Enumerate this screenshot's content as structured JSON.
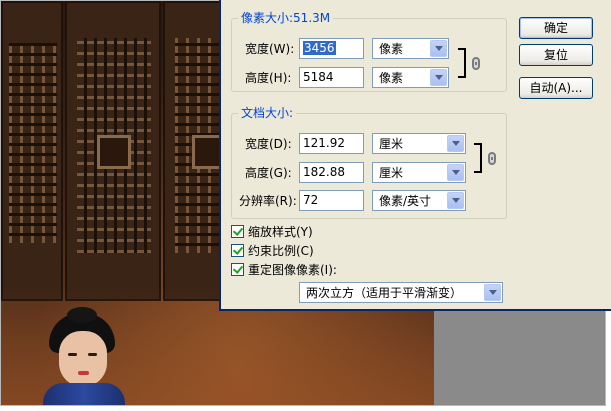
{
  "dialog": {
    "pixel_dimensions": {
      "title": "像素大小:51.3M",
      "width": {
        "label": "宽度(W):",
        "value": "3456",
        "unit": "像素"
      },
      "height": {
        "label": "高度(H):",
        "value": "5184",
        "unit": "像素"
      }
    },
    "document_size": {
      "title": "文档大小:",
      "width": {
        "label": "宽度(D):",
        "value": "121.92",
        "unit": "厘米"
      },
      "height": {
        "label": "高度(G):",
        "value": "182.88",
        "unit": "厘米"
      },
      "resolution": {
        "label": "分辨率(R):",
        "value": "72",
        "unit": "像素/英寸"
      }
    },
    "buttons": {
      "ok": "确定",
      "reset": "复位",
      "auto": "自动(A)..."
    },
    "options": {
      "scale_styles": {
        "label": "缩放样式(Y)",
        "checked": true
      },
      "constrain_proportions": {
        "label": "约束比例(C)",
        "checked": true
      },
      "resample": {
        "label": "重定图像像素(I):",
        "checked": true
      },
      "resample_method": "两次立方（适用于平滑渐变）"
    },
    "colors": {
      "group_title": "#0046d5",
      "dialog_bg": "#ece9d8",
      "selection": "#316ac5"
    }
  }
}
